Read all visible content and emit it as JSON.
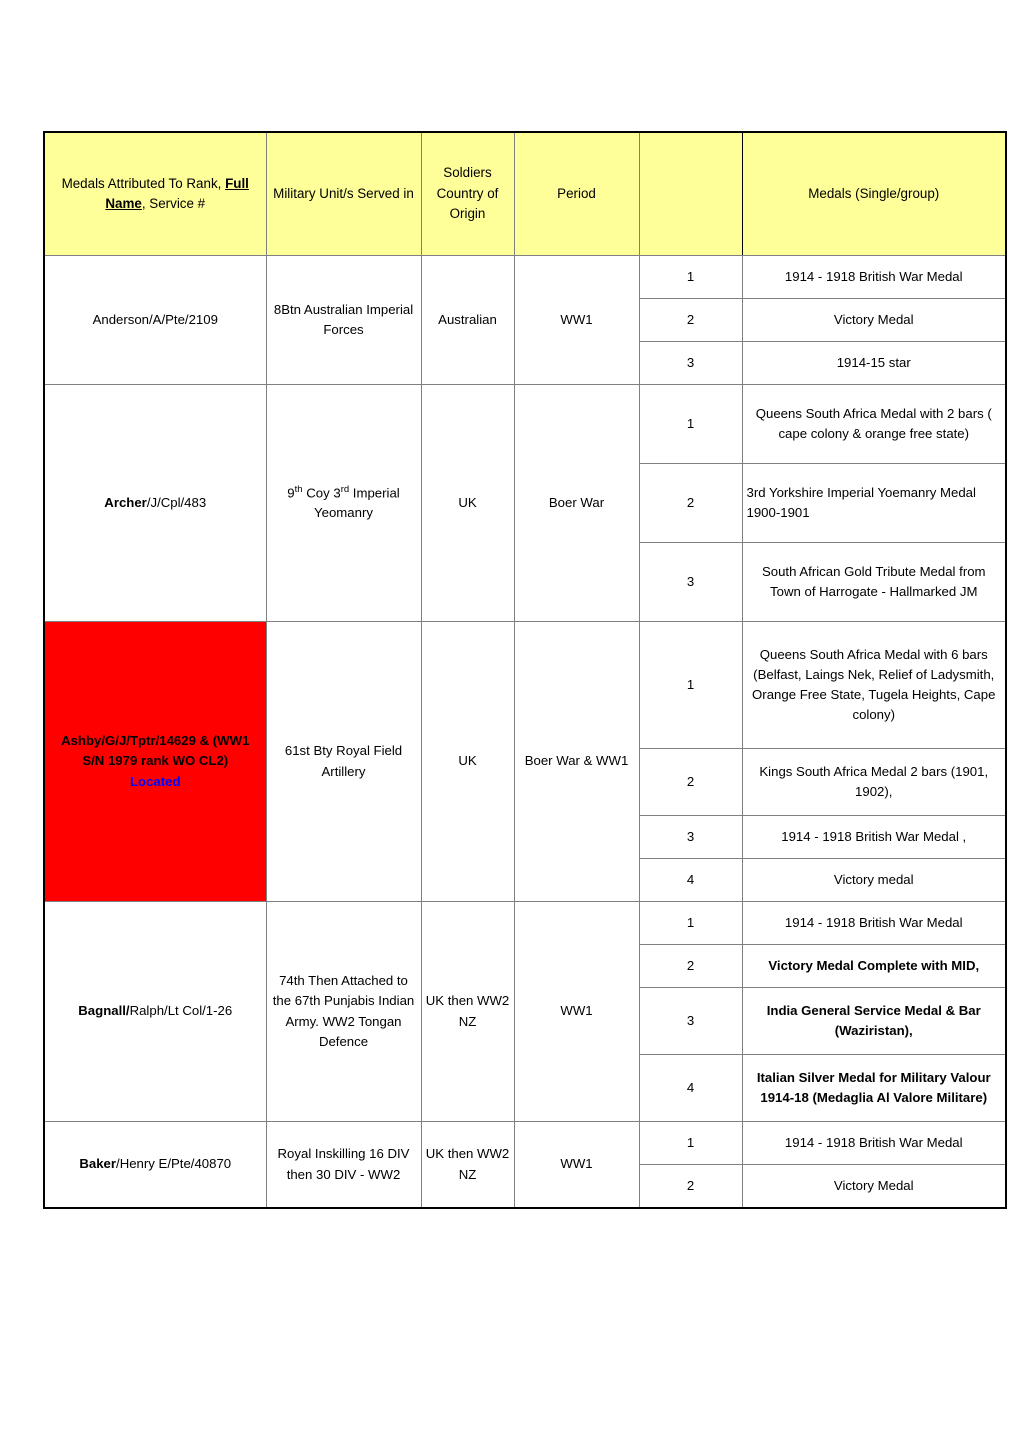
{
  "table": {
    "headers": {
      "name": "Medals Attributed To   Rank, Full Name, Service #",
      "name_part1": "Medals Attributed To   Rank, ",
      "name_part2": "Full Name",
      "name_part3": ", Service #",
      "unit": "Military Unit/s Served in",
      "origin": "Soldiers Country of Origin",
      "period": "Period",
      "number": "",
      "medals": "Medals (Single/group)"
    },
    "colors": {
      "header_background": "#ffff99",
      "highlight_row_background": "#ff0000",
      "located_text": "#0000ff",
      "border": "#000000"
    },
    "rows": [
      {
        "name_bold": "",
        "name_rest": "Anderson/A/Pte/2109",
        "unit": "8Btn Australian Imperial Forces",
        "origin": "Australian",
        "period": "WW1",
        "highlight": false,
        "medals": [
          {
            "no": "1",
            "text": "1914 - 1918 British War Medal",
            "bold": false
          },
          {
            "no": "2",
            "text": "Victory Medal",
            "bold": false
          },
          {
            "no": "3",
            "text": "1914-15 star",
            "bold": false
          }
        ]
      },
      {
        "name_bold": "Archer",
        "name_rest": "/J/Cpl/483",
        "unit_prefix": "9",
        "unit_sup1": "th",
        "unit_mid": " Coy 3",
        "unit_sup2": "rd",
        "unit_suffix": " Imperial Yeomanry",
        "origin": "UK",
        "period": "Boer War",
        "highlight": false,
        "medals": [
          {
            "no": "1",
            "text": "Queens South Africa Medal  with 2 bars ( cape colony & orange free state)",
            "bold": false
          },
          {
            "no": "2",
            "text": "3rd Yorkshire Imperial Yoemanry Medal 1900-1901",
            "bold": false,
            "align": "left"
          },
          {
            "no": "3",
            "text": "South African Gold Tribute Medal from Town of Harrogate - Hallmarked JM",
            "bold": false
          }
        ]
      },
      {
        "name_bold": "Ashby/G/J/Tptr/14629 & (WW1 S/N 1979 rank WO CL2)",
        "name_rest": "",
        "located": "Located",
        "unit": "61st Bty Royal Field Artillery",
        "origin": "UK",
        "period": "Boer War & WW1",
        "highlight": true,
        "medals": [
          {
            "no": "1",
            "text": "Queens South Africa Medal with 6 bars (Belfast, Laings Nek, Relief of Ladysmith, Orange Free State, Tugela Heights, Cape colony)",
            "bold": false
          },
          {
            "no": "2",
            "text": "Kings South Africa Medal 2 bars (1901, 1902),",
            "bold": false
          },
          {
            "no": "3",
            "text": "1914 - 1918  British War Medal ,",
            "bold": false
          },
          {
            "no": "4",
            "text": "Victory medal",
            "bold": false
          }
        ]
      },
      {
        "name_bold": "Bagnall/",
        "name_rest": "Ralph/Lt Col/1-26",
        "unit": "74th Then Attached to the 67th Punjabis Indian Army. WW2 Tongan Defence",
        "origin": "UK then WW2 NZ",
        "period": "WW1",
        "highlight": false,
        "medals": [
          {
            "no": "1",
            "text": "1914 - 1918 British War Medal",
            "bold": false
          },
          {
            "no": "2",
            "text": "Victory Medal Complete with MID,",
            "bold": true
          },
          {
            "no": "3",
            "text": "India General Service Medal & Bar (Waziristan),",
            "bold": true
          },
          {
            "no": "4",
            "text": "Italian Silver Medal for Military Valour 1914-18 (Medaglia Al Valore Militare)",
            "bold": true
          }
        ]
      },
      {
        "name_bold": "Baker",
        "name_rest": "/Henry E/Pte/40870",
        "unit": "Royal Inskilling 16 DIV then 30 DIV - WW2",
        "origin": "UK then WW2 NZ",
        "period": "WW1",
        "highlight": false,
        "medals": [
          {
            "no": "1",
            "text": "1914 - 1918 British War Medal",
            "bold": false
          },
          {
            "no": "2",
            "text": "Victory Medal",
            "bold": false
          }
        ]
      }
    ]
  }
}
